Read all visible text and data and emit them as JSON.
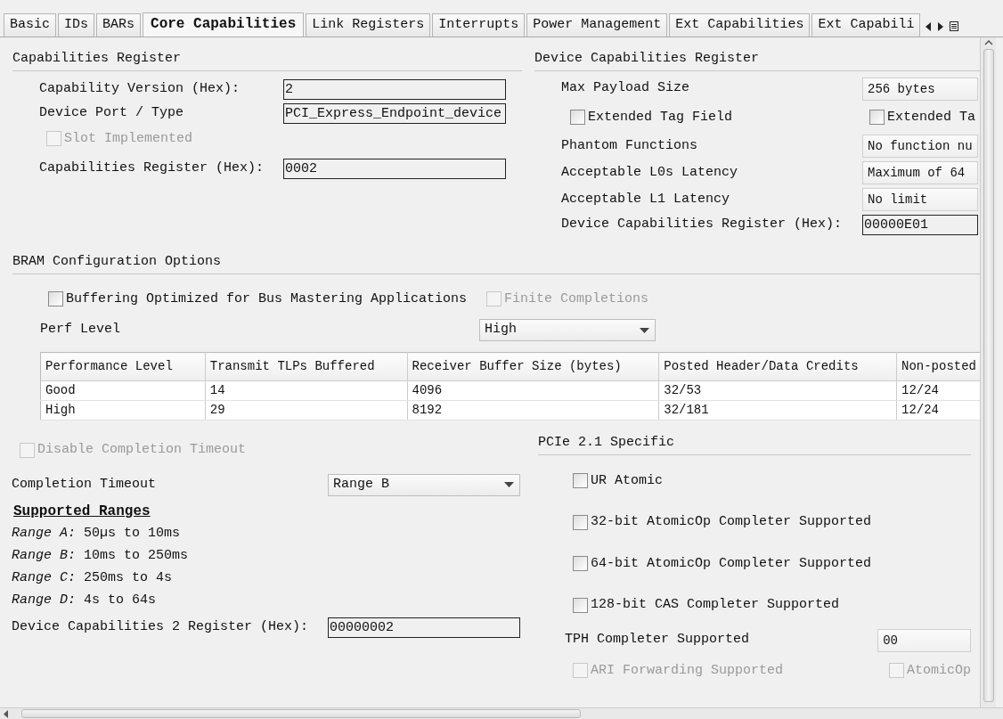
{
  "tabs": [
    {
      "label": "Basic",
      "selected": false
    },
    {
      "label": "IDs",
      "selected": false
    },
    {
      "label": "BARs",
      "selected": false
    },
    {
      "label": "Core Capabilities",
      "selected": true
    },
    {
      "label": "Link Registers",
      "selected": false
    },
    {
      "label": "Interrupts",
      "selected": false
    },
    {
      "label": "Power Management",
      "selected": false
    },
    {
      "label": "Ext Capabilities",
      "selected": false
    },
    {
      "label": "Ext Capabili",
      "selected": false
    }
  ],
  "capabilities_register": {
    "title": "Capabilities Register",
    "fields": [
      {
        "kind": "text",
        "label": "Capability Version (Hex):",
        "value": "2"
      },
      {
        "kind": "text",
        "label": "Device Port / Type",
        "value": "PCI_Express_Endpoint_device"
      },
      {
        "kind": "checkbox",
        "label": "Slot Implemented",
        "checked": false,
        "disabled": true
      },
      {
        "kind": "text",
        "label": "Capabilities Register (Hex):",
        "value": "0002"
      }
    ]
  },
  "device_capabilities_register": {
    "title": "Device Capabilities Register",
    "fields": [
      {
        "kind": "value_box",
        "label": "Max Payload Size",
        "value": "256 bytes"
      },
      {
        "kind": "checkbox_pair",
        "items": [
          {
            "label": "Extended Tag Field",
            "checked": false,
            "disabled": false
          },
          {
            "label": "Extended Ta",
            "checked": false,
            "disabled": false
          }
        ]
      },
      {
        "kind": "value_box",
        "label": "Phantom Functions",
        "value": "No function nu"
      },
      {
        "kind": "value_box",
        "label": "Acceptable L0s Latency",
        "value": "Maximum of 64"
      },
      {
        "kind": "value_box",
        "label": "Acceptable L1 Latency",
        "value": "No limit"
      },
      {
        "kind": "text",
        "label": "Device Capabilities Register (Hex):",
        "value": "00000E01"
      }
    ]
  },
  "bram_configuration": {
    "title": "BRAM Configuration Options",
    "checkboxes": [
      {
        "label": "Buffering Optimized for Bus Mastering Applications",
        "checked": false,
        "disabled": false
      },
      {
        "label": "Finite Completions",
        "checked": false,
        "disabled": true
      }
    ],
    "perf_level": {
      "label": "Perf Level",
      "value": "High"
    },
    "table": {
      "columns": [
        "Performance Level",
        "Transmit TLPs Buffered",
        "Receiver Buffer Size (bytes)",
        "Posted Header/Data Credits",
        "Non-posted"
      ],
      "rows": [
        [
          "Good",
          "14",
          "4096",
          "32/53",
          "12/24"
        ],
        [
          "High",
          "29",
          "8192",
          "32/181",
          "12/24"
        ]
      ]
    }
  },
  "completion": {
    "disable_checkbox": {
      "label": "Disable Completion Timeout",
      "checked": false,
      "disabled": true
    },
    "timeout": {
      "label": "Completion Timeout",
      "value": "Range B"
    },
    "supported_ranges_title": "Supported Ranges",
    "ranges": [
      "*Range A:* 50µs to 10ms",
      "*Range B:* 10ms to 250ms",
      "*Range C:* 250ms to 4s",
      "*Range D:* 4s to 64s"
    ],
    "register": {
      "label": "Device Capabilities 2 Register (Hex):",
      "value": "00000002"
    }
  },
  "pcie_2_1_specific": {
    "title": "PCIe 2.1 Specific",
    "checkboxes": [
      {
        "label": "UR Atomic",
        "checked": false,
        "disabled": false
      },
      {
        "label": "32-bit AtomicOp Completer Supported",
        "checked": false,
        "disabled": false
      },
      {
        "label": "64-bit AtomicOp Completer Supported",
        "checked": false,
        "disabled": false
      },
      {
        "label": "128-bit CAS Completer Supported",
        "checked": false,
        "disabled": false
      }
    ],
    "tph": {
      "label": "TPH Completer Supported",
      "value": "00"
    },
    "bottom_checkboxes": [
      {
        "label": "ARI Forwarding Supported",
        "checked": false,
        "disabled": true
      },
      {
        "label": "AtomicOp",
        "checked": false,
        "disabled": true
      }
    ]
  }
}
